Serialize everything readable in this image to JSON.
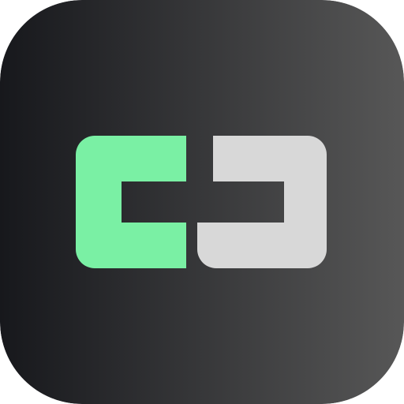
{
  "app_icon": {
    "name": "link-icon",
    "background_gradient": {
      "from": "#17181c",
      "to": "#575757",
      "direction": "left-to-right"
    },
    "left_bracket_color": "#7af0a4",
    "right_bracket_color": "#d8d8d8",
    "cutout_color": "#2b2c2f"
  }
}
